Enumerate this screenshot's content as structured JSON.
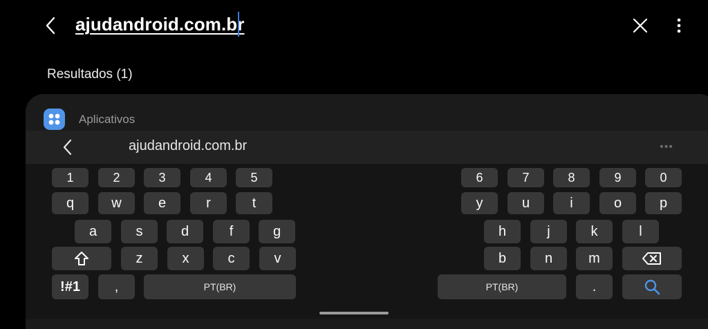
{
  "header": {
    "search_query": "ajudandroid.com.br",
    "back_icon": "chevron-left-icon",
    "clear_icon": "close-icon",
    "more_icon": "more-vertical-icon"
  },
  "results": {
    "label": "Resultados (1)",
    "category": "Aplicativos"
  },
  "keyboard": {
    "toolbar_text": "ajudandroid.com.br",
    "toolbar_dots": "•••",
    "left_rows": [
      [
        "1",
        "2",
        "3",
        "4",
        "5"
      ],
      [
        "q",
        "w",
        "e",
        "r",
        "t"
      ],
      [
        "a",
        "s",
        "d",
        "f",
        "g"
      ],
      [
        "z",
        "x",
        "c",
        "v"
      ]
    ],
    "right_rows": [
      [
        "6",
        "7",
        "8",
        "9",
        "0"
      ],
      [
        "y",
        "u",
        "i",
        "o",
        "p"
      ],
      [
        "h",
        "j",
        "k",
        "l"
      ],
      [
        "b",
        "n",
        "m"
      ]
    ],
    "symbols_label": "!#1",
    "comma_label": ",",
    "period_label": ".",
    "space_left_label": "PT(BR)",
    "space_right_label": "PT(BR)"
  },
  "colors": {
    "accent": "#3f7be0",
    "app_icon": "#4f94e8",
    "key": "#383838",
    "card": "#1b1b1b"
  }
}
